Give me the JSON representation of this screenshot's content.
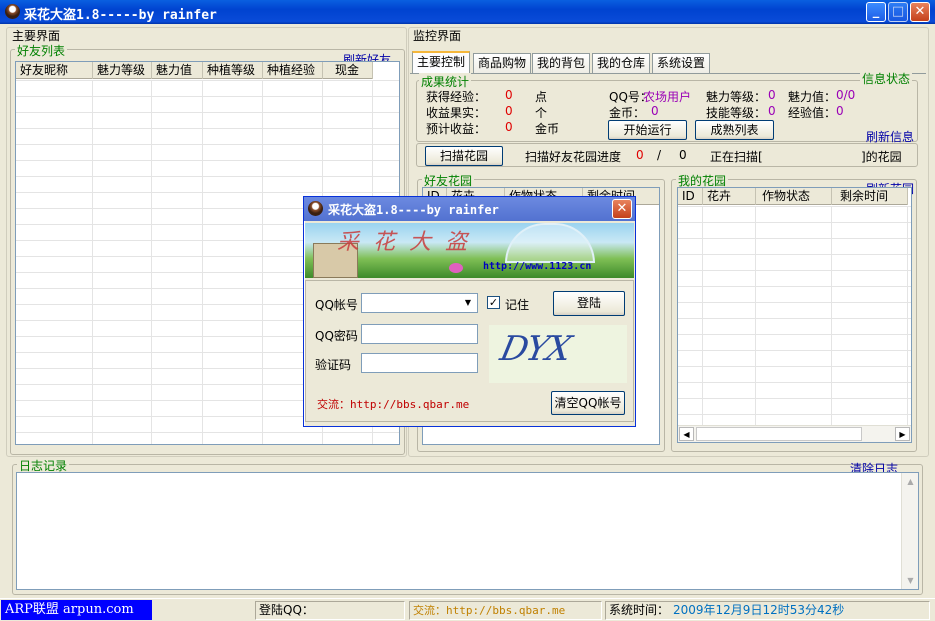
{
  "window": {
    "title": "采花大盗1.8-----by rainfer"
  },
  "main_panel": {
    "title": "主要界面",
    "friends_group": "好友列表",
    "refresh_friends": "刷新好友",
    "columns": [
      "好友昵称",
      "魅力等级",
      "魅力值",
      "种植等级",
      "种植经验",
      "现金"
    ]
  },
  "monitor": {
    "title": "监控界面",
    "tabs": [
      "主要控制",
      "商品购物",
      "我的背包",
      "我的仓库",
      "系统设置"
    ],
    "results_group": "成果统计",
    "info_status": "信息状态",
    "exp_label": "获得经验：",
    "exp_value": "0",
    "exp_unit": "点",
    "fruit_label": "收益果实：",
    "fruit_value": "0",
    "fruit_unit": "个",
    "income_label": "预计收益：",
    "income_value": "0",
    "income_unit": "金币",
    "qq_label": "QQ号：",
    "qq_value": "农场用户",
    "gold_label": "金币：",
    "gold_value": "0",
    "charm_level_label": "魅力等级：",
    "charm_level_value": "0",
    "charm_label": "魅力值：",
    "charm_value": "0/0",
    "skill_label": "技能等级：",
    "skill_value": "0",
    "xp_label": "经验值：",
    "xp_value": "0",
    "start_btn": "开始运行",
    "mature_btn": "成熟列表",
    "refresh_info": "刷新信息",
    "scan_btn": "扫描花园",
    "scan_progress_label": "扫描好友花园进度",
    "scan_current": "0",
    "scan_sep": "/",
    "scan_total": "0",
    "scanning_label": "正在扫描[",
    "scanning_suffix": "]的花园"
  },
  "friend_garden": {
    "title": "好友花园",
    "columns": [
      "ID",
      "花卉",
      "作物状态",
      "剩余时间"
    ]
  },
  "my_garden": {
    "title": "我的花园",
    "refresh": "刷新花园",
    "columns": [
      "ID",
      "花卉",
      "作物状态",
      "剩余时间"
    ]
  },
  "log": {
    "title": "日志记录",
    "clear": "清除日志"
  },
  "statusbar": {
    "brand": "ARP联盟 arpun.com",
    "login_qq": "登陆QQ：",
    "exchange": "交流：http://bbs.qbar.me",
    "time_label": "系统时间：",
    "time_value": "2009年12月9日12时53分42秒"
  },
  "dialog": {
    "title": "采花大盗1.8----by rainfer",
    "banner_text": "采花大盗",
    "banner_url": "http://www.1123.cn",
    "qq_label": "QQ帐号",
    "pwd_label": "QQ密码",
    "captcha_label": "验证码",
    "remember_label": "记住",
    "login_btn": "登陆",
    "captcha_text": "DYX",
    "exchange": "交流：http://bbs.qbar.me",
    "clear_btn": "清空QQ帐号"
  },
  "colors": {
    "title_blue": "#0a4bd8",
    "legend_green": "#008000",
    "value_red": "#e00000",
    "value_purple": "#9a00b6",
    "link_navy": "#0000a8",
    "brand_blue": "#0000ff"
  }
}
